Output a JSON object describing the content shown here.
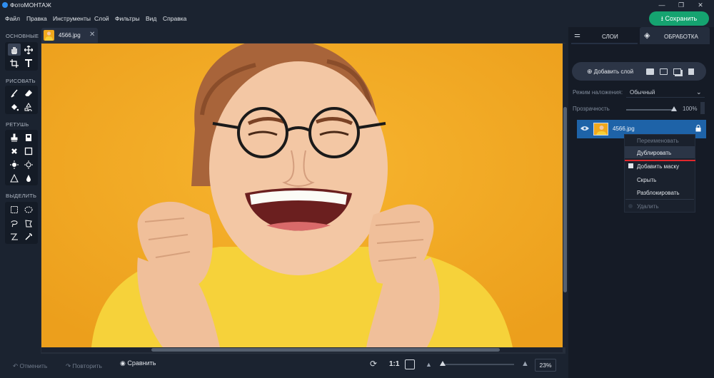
{
  "window": {
    "title": "ФотоМОНТАЖ",
    "controls": [
      "—",
      "❐",
      "✕"
    ]
  },
  "menu": [
    "Файл",
    "Правка",
    "Инструменты",
    "Слой",
    "Фильтры",
    "Вид",
    "Справка"
  ],
  "save_label": "Сохранить",
  "tools": {
    "basic": "ОСНОВНЫЕ",
    "draw": "РИСОВАТЬ",
    "retouch": "РЕТУШЬ",
    "select": "ВЫДЕЛИТЬ"
  },
  "doc": {
    "name": "4566.jpg"
  },
  "bottom": {
    "undo": "Отменить",
    "redo": "Повторить",
    "compare": "Сравнить",
    "ratio": "1:1",
    "zoom": "23%",
    "zoom_level": 23
  },
  "panel": {
    "tab_layers": "СЛОИ",
    "tab_process": "ОБРАБОТКА",
    "add_layer": "Добавить слой",
    "blend_label": "Режим наложения:",
    "blend_value": "Обычный",
    "opacity_label": "Прозрачность",
    "opacity_value": "100%",
    "opacity_level": 100,
    "layer_name": "4566.jpg"
  },
  "context_menu": {
    "items": [
      {
        "label": "Переименовать",
        "enabled": false
      },
      {
        "label": "Дублировать",
        "enabled": true,
        "highlighted": true
      },
      {
        "label": "Добавить маску",
        "enabled": true
      },
      {
        "label": "Скрыть",
        "enabled": true
      },
      {
        "label": "Разблокировать",
        "enabled": true
      },
      {
        "label": "Удалить",
        "enabled": false
      }
    ]
  },
  "colors": {
    "accent": "#15a370",
    "selection": "#1e63a8",
    "background": "#f4ad27",
    "underline": "#e0282d"
  }
}
